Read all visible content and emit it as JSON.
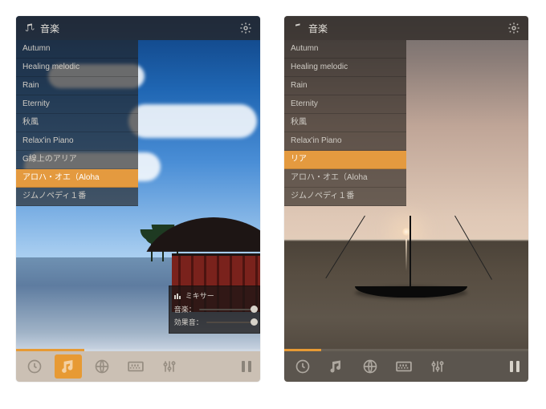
{
  "app": {
    "title": "音楽"
  },
  "playlist": {
    "items": [
      {
        "label": "Autumn"
      },
      {
        "label": "Healing melodic"
      },
      {
        "label": "Rain"
      },
      {
        "label": "Eternity"
      },
      {
        "label": "秋風"
      },
      {
        "label": "Relax'in Piano"
      },
      {
        "label": "G線上のアリア"
      },
      {
        "label": "アロハ・オエ（Aloha"
      },
      {
        "label": "ジムノペディ１番"
      }
    ],
    "selected_index_left": 7,
    "selected_index_right": 6,
    "right_item_6_label": "リア",
    "right_item_7_label": "アロハ・オエ（Aloha"
  },
  "mixer": {
    "title": "ミキサー",
    "row1_label": "音楽：",
    "row2_label": "効果音：",
    "music_value": 100,
    "sfx_value": 100
  },
  "progress": {
    "left_percent": 28,
    "right_percent": 15
  },
  "tabs": {
    "items": [
      "clock",
      "music",
      "globe",
      "keyboard",
      "equalizer"
    ],
    "active_left": 1,
    "active_right": 1
  },
  "colors": {
    "accent": "#e79a34"
  }
}
